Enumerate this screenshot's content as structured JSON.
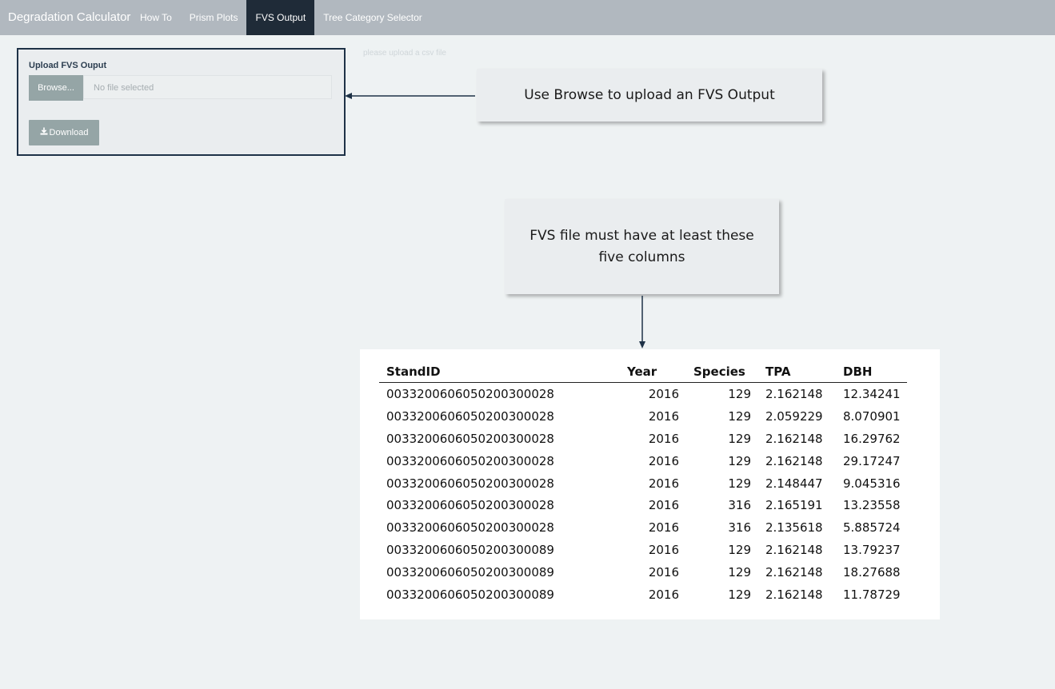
{
  "navbar": {
    "brand": "Degradation Calculator",
    "tabs": [
      {
        "label": "How To"
      },
      {
        "label": "Prism Plots"
      },
      {
        "label": "FVS Output"
      },
      {
        "label": "Tree Category Selector"
      }
    ],
    "active_tab": "FVS Output",
    "background": "#b1b8bf",
    "active_background": "#1f2b38"
  },
  "upload": {
    "label": "Upload FVS Ouput",
    "browse_label": "Browse...",
    "file_placeholder": "No file selected",
    "download_label": "Download",
    "download_icon": "download-icon"
  },
  "hint": "please upload a csv file",
  "callouts": {
    "browse": "Use Browse to upload an FVS Output",
    "columns": "FVS file must have at least these five columns"
  },
  "table": {
    "headers": [
      "StandID",
      "Year",
      "Species",
      "TPA",
      "DBH"
    ],
    "rows": [
      [
        "0033200606050200300028",
        "2016",
        "129",
        "2.162148",
        "12.34241"
      ],
      [
        "0033200606050200300028",
        "2016",
        "129",
        "2.059229",
        "8.070901"
      ],
      [
        "0033200606050200300028",
        "2016",
        "129",
        "2.162148",
        "16.29762"
      ],
      [
        "0033200606050200300028",
        "2016",
        "129",
        "2.162148",
        "29.17247"
      ],
      [
        "0033200606050200300028",
        "2016",
        "129",
        "2.148447",
        "9.045316"
      ],
      [
        "0033200606050200300028",
        "2016",
        "316",
        "2.165191",
        "13.23558"
      ],
      [
        "0033200606050200300028",
        "2016",
        "316",
        "2.135618",
        "5.885724"
      ],
      [
        "0033200606050200300089",
        "2016",
        "129",
        "2.162148",
        "13.79237"
      ],
      [
        "0033200606050200300089",
        "2016",
        "129",
        "2.162148",
        "18.27688"
      ],
      [
        "0033200606050200300089",
        "2016",
        "129",
        "2.162148",
        "11.78729"
      ]
    ]
  }
}
